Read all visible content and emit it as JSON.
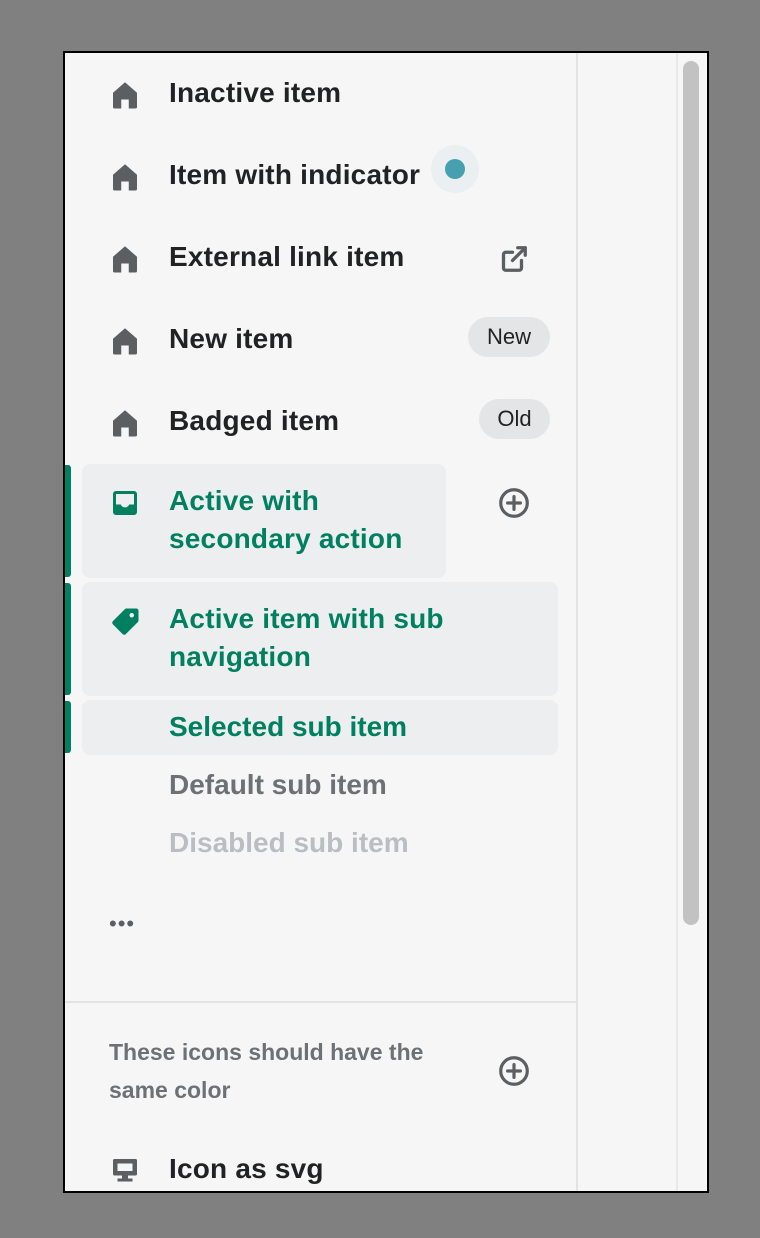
{
  "nav": {
    "items": [
      {
        "label": "Inactive item",
        "icon": "home-icon"
      },
      {
        "label": "Item with indicator",
        "icon": "home-icon"
      },
      {
        "label": "External link item",
        "icon": "home-icon",
        "action_icon": "external-link-icon"
      },
      {
        "label": "New item",
        "icon": "home-icon",
        "badge": "New"
      },
      {
        "label": "Badged item",
        "icon": "home-icon",
        "badge": "Old"
      }
    ],
    "active_secondary": {
      "label_line1": "Active with",
      "label_line2": "secondary action",
      "icon": "inbox-icon",
      "action_icon": "plus-circle-icon"
    },
    "active_sub_nav": {
      "label_line1": "Active item with sub",
      "label_line2": "navigation",
      "icon": "tag-icon"
    },
    "sub_items": [
      {
        "label": "Selected sub item",
        "state": "selected"
      },
      {
        "label": "Default sub item",
        "state": "default"
      },
      {
        "label": "Disabled sub item",
        "state": "disabled"
      }
    ],
    "more_label": "•••"
  },
  "section": {
    "title": "These icons should have the same color",
    "action_icon": "plus-circle-icon",
    "item_label": "Icon as svg",
    "item_icon": "monitor-icon"
  },
  "colors": {
    "active": "#008060",
    "text": "#202223",
    "subdued": "#6d7175",
    "disabled": "#babec3",
    "icon": "#5c5f62",
    "indicator": "#47a0b0"
  }
}
